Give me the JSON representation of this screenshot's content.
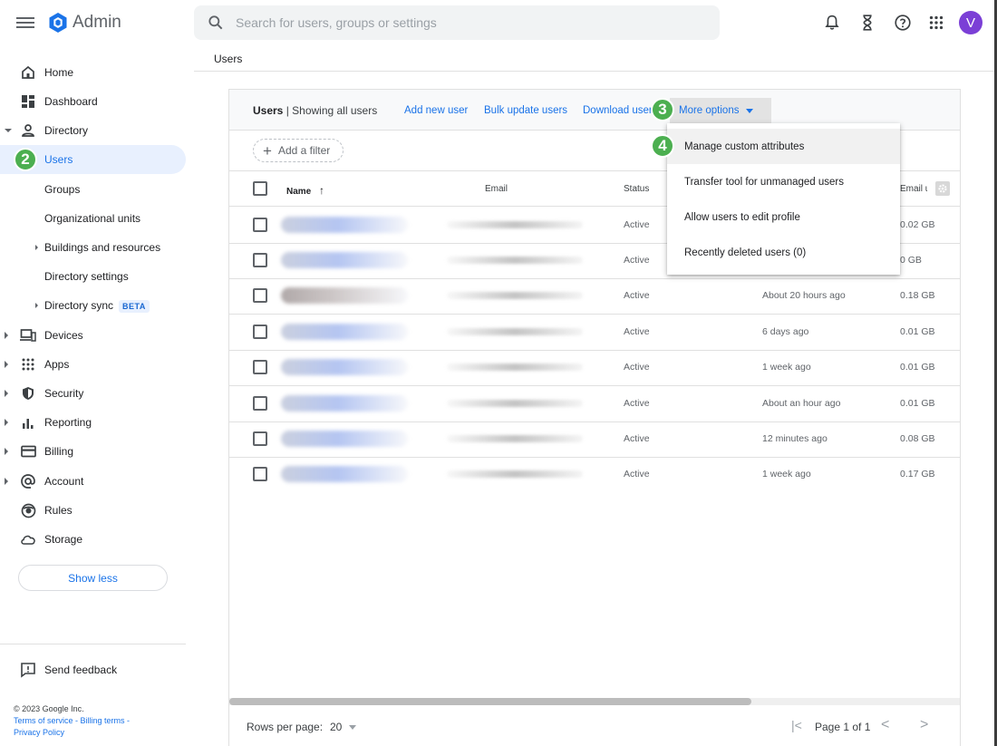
{
  "app": {
    "title": "Admin",
    "avatar_letter": "V"
  },
  "search": {
    "placeholder": "Search for users, groups or settings"
  },
  "breadcrumb": "Users",
  "sidebar": {
    "items": [
      {
        "label": "Home",
        "icon": "home-icon"
      },
      {
        "label": "Dashboard",
        "icon": "dashboard-icon"
      },
      {
        "label": "Directory",
        "icon": "person-icon"
      },
      {
        "label": "Users"
      },
      {
        "label": "Groups"
      },
      {
        "label": "Organizational units"
      },
      {
        "label": "Buildings and resources"
      },
      {
        "label": "Directory settings"
      },
      {
        "label": "Directory sync",
        "badge": "BETA"
      },
      {
        "label": "Devices",
        "icon": "devices-icon"
      },
      {
        "label": "Apps",
        "icon": "apps-grid-icon"
      },
      {
        "label": "Security",
        "icon": "shield-icon"
      },
      {
        "label": "Reporting",
        "icon": "bar-chart-icon"
      },
      {
        "label": "Billing",
        "icon": "credit-card-icon"
      },
      {
        "label": "Account",
        "icon": "at-icon"
      },
      {
        "label": "Rules",
        "icon": "rules-icon"
      },
      {
        "label": "Storage",
        "icon": "cloud-icon"
      }
    ],
    "show_less": "Show less",
    "feedback": "Send feedback",
    "copyright": "© 2023 Google Inc.",
    "terms": "Terms of service",
    "billing_terms": "Billing terms",
    "privacy": "Privacy Policy"
  },
  "badges": {
    "users": "2",
    "more_options": "3",
    "manage": "4"
  },
  "panel": {
    "title_bold": "Users",
    "title_rest": " | Showing all users",
    "add_new_user": "Add new user",
    "bulk_update": "Bulk update users",
    "download_users": "Download users",
    "more_options": "More options",
    "add_filter": "Add a filter"
  },
  "table": {
    "headers": {
      "name": "Name",
      "email": "Email",
      "status": "Status",
      "email_usage": "Email usage"
    },
    "rows": [
      {
        "status": "Active",
        "last_sign_in": "",
        "storage": "0.02 GB"
      },
      {
        "status": "Active",
        "last_sign_in": "",
        "storage": "0 GB"
      },
      {
        "status": "Active",
        "last_sign_in": "About 20 hours ago",
        "storage": "0.18 GB"
      },
      {
        "status": "Active",
        "last_sign_in": "6 days ago",
        "storage": "0.01 GB"
      },
      {
        "status": "Active",
        "last_sign_in": "1 week ago",
        "storage": "0.01 GB"
      },
      {
        "status": "Active",
        "last_sign_in": "About an hour ago",
        "storage": "0.01 GB"
      },
      {
        "status": "Active",
        "last_sign_in": "12 minutes ago",
        "storage": "0.08 GB"
      },
      {
        "status": "Active",
        "last_sign_in": "1 week ago",
        "storage": "0.17 GB"
      }
    ]
  },
  "pager": {
    "rows_per_page_label": "Rows per page:",
    "rows_per_page": "20",
    "page_label": "Page 1 of 1"
  },
  "menu": {
    "items": [
      "Manage custom attributes",
      "Transfer tool for unmanaged users",
      "Allow users to edit profile",
      "Recently deleted users (0)"
    ]
  },
  "colors": {
    "accent": "#1a73e8",
    "badge_green": "#4caf50",
    "avatar": "#7b3fd6"
  }
}
